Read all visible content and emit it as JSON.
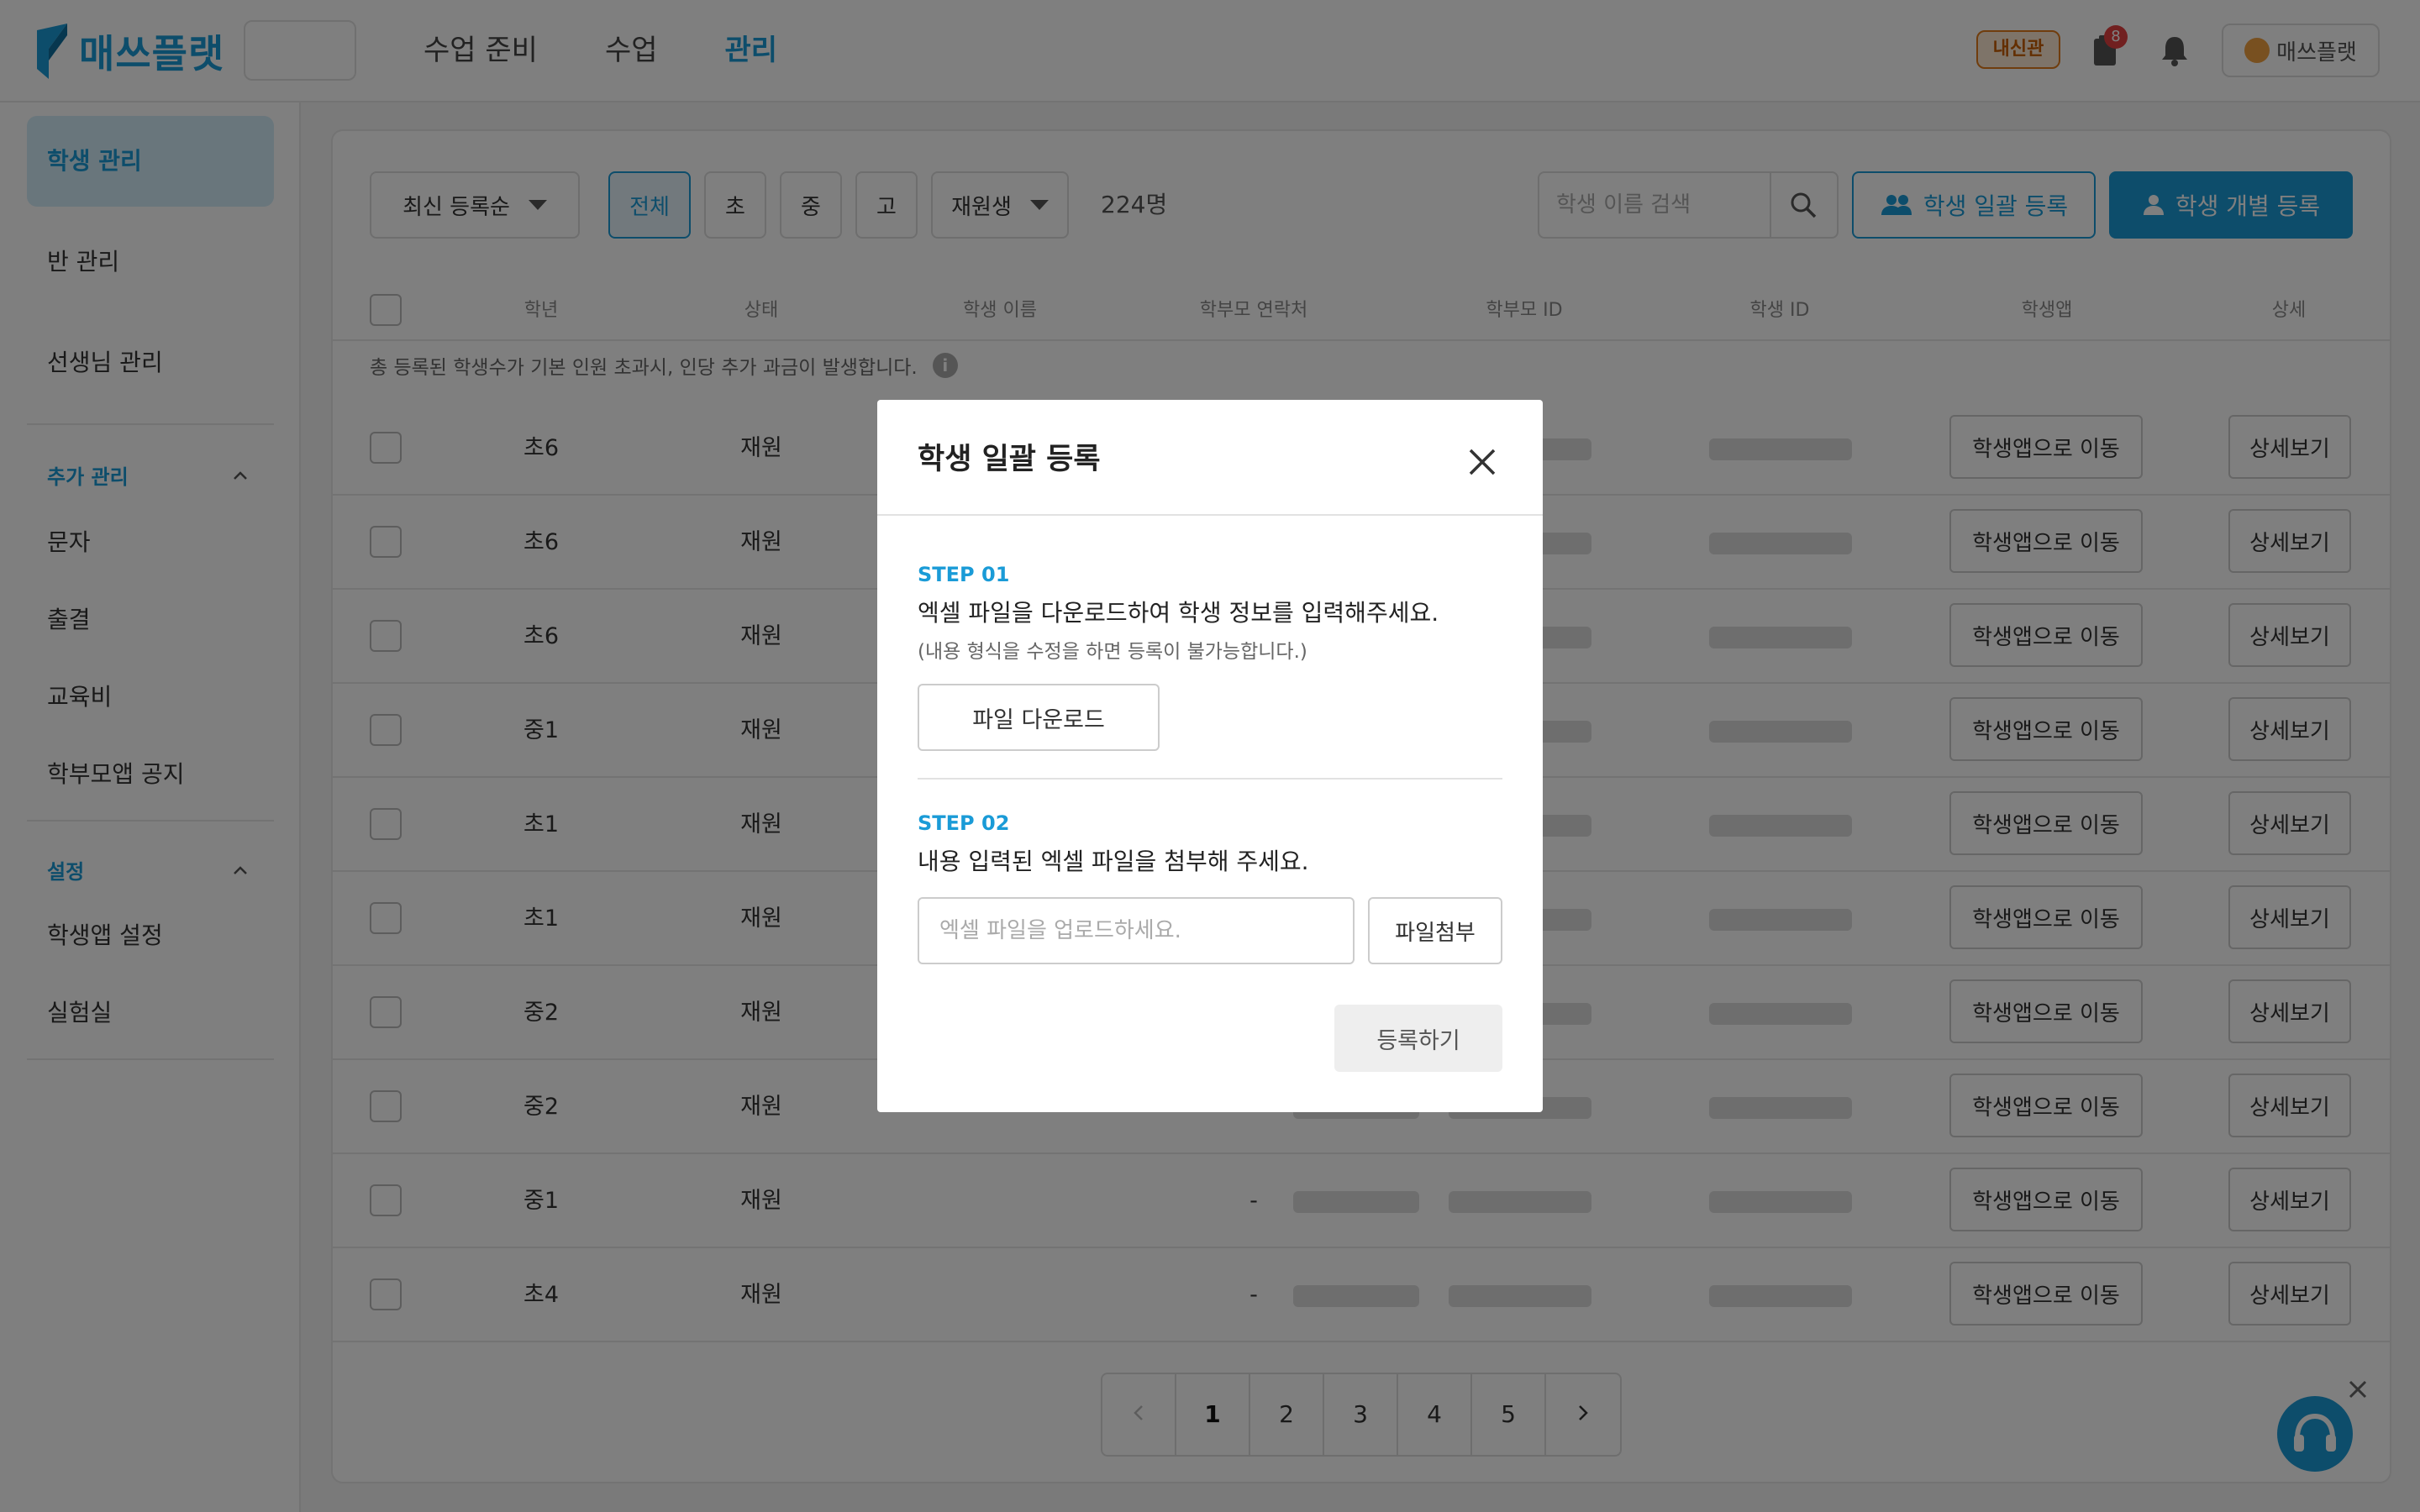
{
  "header": {
    "logo_text": "매쓰플랫",
    "nav": [
      {
        "label": "수업 준비",
        "active": false
      },
      {
        "label": "수업",
        "active": false
      },
      {
        "label": "관리",
        "active": true
      }
    ],
    "naesin_badge": "내신관",
    "notification_count": "8",
    "user_name": "매쓰플랫"
  },
  "sidebar": {
    "items": [
      {
        "label": "학생 관리",
        "active": true
      },
      {
        "label": "반 관리",
        "active": false
      },
      {
        "label": "선생님 관리",
        "active": false
      }
    ],
    "sections": [
      {
        "title": "추가 관리",
        "items": [
          "문자",
          "출결",
          "교육비",
          "학부모앱 공지"
        ]
      },
      {
        "title": "설정",
        "items": [
          "학생앱 설정",
          "실험실"
        ]
      }
    ]
  },
  "toolbar": {
    "sort_select": "최신 등록순",
    "grade_filters": [
      "전체",
      "초",
      "중",
      "고"
    ],
    "status_select": "재원생",
    "count": "224명",
    "search_placeholder": "학생 이름 검색",
    "bulk_register": "학생 일괄 등록",
    "single_register": "학생 개별 등록"
  },
  "table": {
    "columns": [
      "학년",
      "상태",
      "학생 이름",
      "학부모 연락처",
      "학부모 ID",
      "학생 ID",
      "학생앱",
      "상세"
    ],
    "notice": "총 등록된 학생수가 기본 인원 초과시, 인당 추가 과금이 발생합니다.",
    "app_button": "학생앱으로 이동",
    "detail_button": "상세보기",
    "rows": [
      {
        "grade": "초6",
        "status": "재원",
        "parent_phone": ""
      },
      {
        "grade": "초6",
        "status": "재원",
        "parent_phone": ""
      },
      {
        "grade": "초6",
        "status": "재원",
        "parent_phone": ""
      },
      {
        "grade": "중1",
        "status": "재원",
        "parent_phone": ""
      },
      {
        "grade": "초1",
        "status": "재원",
        "parent_phone": ""
      },
      {
        "grade": "초1",
        "status": "재원",
        "parent_phone": ""
      },
      {
        "grade": "중2",
        "status": "재원",
        "parent_phone": ""
      },
      {
        "grade": "중2",
        "status": "재원",
        "parent_phone": ""
      },
      {
        "grade": "중1",
        "status": "재원",
        "parent_phone": "-"
      },
      {
        "grade": "초4",
        "status": "재원",
        "parent_phone": "-"
      }
    ]
  },
  "pagination": {
    "pages": [
      "1",
      "2",
      "3",
      "4",
      "5"
    ],
    "current": "1"
  },
  "modal": {
    "title": "학생 일괄 등록",
    "step1_label": "STEP 01",
    "step1_desc": "엑셀 파일을 다운로드하여 학생 정보를 입력해주세요.",
    "step1_note": "(내용 형식을 수정을 하면 등록이 불가능합니다.)",
    "download_button": "파일 다운로드",
    "step2_label": "STEP 02",
    "step2_desc": "내용 입력된 엑셀 파일을 첨부해 주세요.",
    "upload_placeholder": "엑셀 파일을 업로드하세요.",
    "attach_button": "파일첨부",
    "submit_button": "등록하기"
  },
  "colors": {
    "accent": "#1a9bd7",
    "overlay": "rgba(0,0,0,0.5)"
  }
}
